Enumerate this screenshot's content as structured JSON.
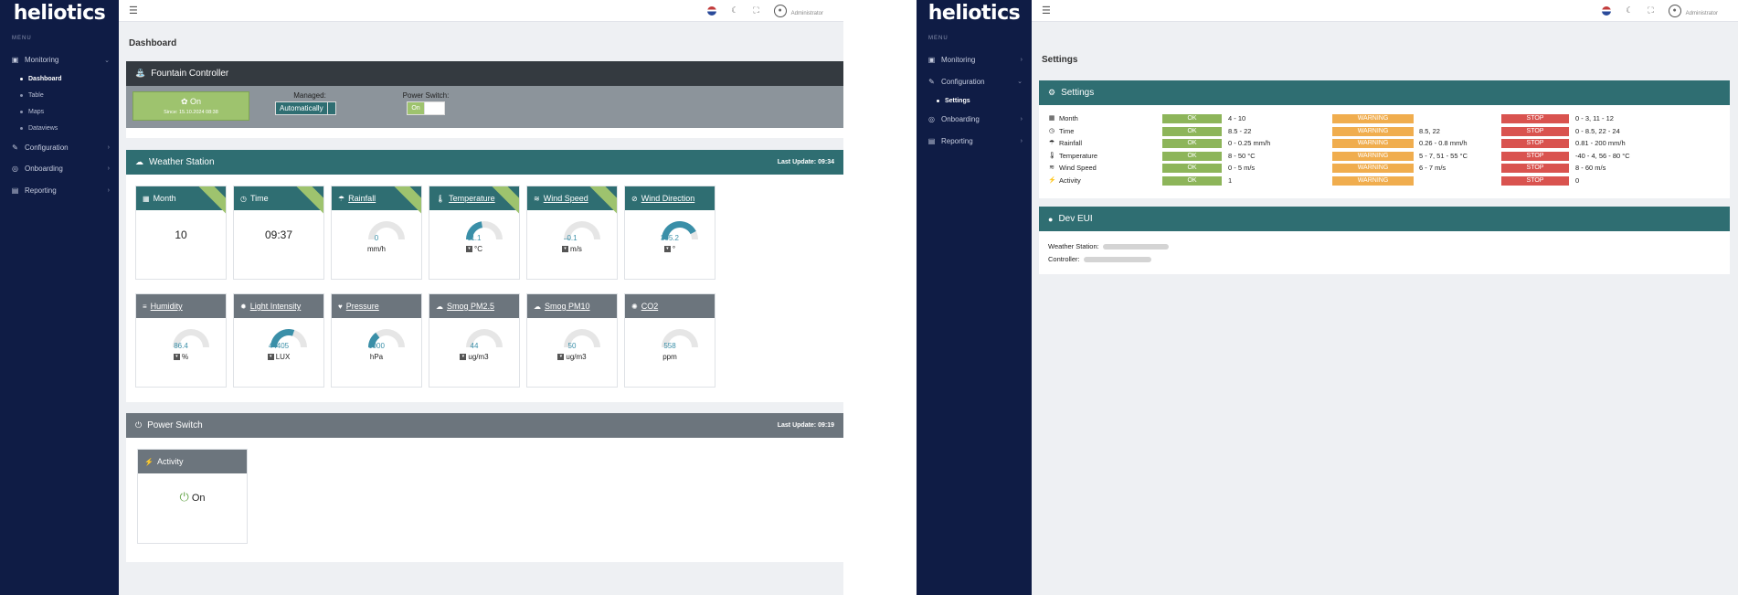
{
  "brand": "heliotics",
  "topbar": {
    "user": "Administrator"
  },
  "menu_label": "MENU",
  "screen1": {
    "sidebar": {
      "items": [
        {
          "label": "Monitoring",
          "chev": "⌄"
        },
        {
          "label": "Configuration",
          "chev": "›"
        },
        {
          "label": "Onboarding",
          "chev": "›"
        },
        {
          "label": "Reporting",
          "chev": "›"
        }
      ],
      "sub": [
        "Dashboard",
        "Table",
        "Maps",
        "Dataviews"
      ]
    },
    "title": "Dashboard",
    "fountain": {
      "title": "Fountain Controller",
      "on_label": "On",
      "since": "Since: 15.10.2024 08:38",
      "managed_label": "Managed:",
      "managed_value": "Automatically",
      "power_label": "Power Switch:",
      "power_value": "On"
    },
    "weather": {
      "title": "Weather Station",
      "last_update": "Last Update: 09:34",
      "tiles": [
        {
          "label": "Month",
          "value": "10"
        },
        {
          "label": "Time",
          "value": "09:37"
        },
        {
          "label": "Rainfall",
          "value": "0",
          "unit": "mm/h",
          "level": 0.0
        },
        {
          "label": "Temperature",
          "value": "11.1",
          "unit": "°C",
          "level": 0.45
        },
        {
          "label": "Wind Speed",
          "value": "0.1",
          "unit": "m/s",
          "level": 0.01
        },
        {
          "label": "Wind Direction",
          "value": "305.2",
          "unit": "°",
          "level": 0.85
        },
        {
          "label": "Humidity",
          "value": "86.4",
          "unit": "%",
          "level": 0.0
        },
        {
          "label": "Light Intensity",
          "value": "44405",
          "unit": "LUX",
          "level": 0.6
        },
        {
          "label": "Pressure",
          "value": "1000",
          "unit": "hPa",
          "level": 0.3
        },
        {
          "label": "Smog PM2.5",
          "value": "44",
          "unit": "ug/m3",
          "level": 0.0
        },
        {
          "label": "Smog PM10",
          "value": "50",
          "unit": "ug/m3",
          "level": 0.0
        },
        {
          "label": "CO2",
          "value": "558",
          "unit": "ppm",
          "level": 0.0
        }
      ]
    },
    "power": {
      "title": "Power Switch",
      "last_update": "Last Update: 09:19",
      "activity_label": "Activity",
      "activity_value": "On"
    }
  },
  "screen2": {
    "sidebar": {
      "items": [
        {
          "label": "Monitoring",
          "chev": "›"
        },
        {
          "label": "Configuration",
          "chev": "⌄"
        },
        {
          "label": "Onboarding",
          "chev": "›"
        },
        {
          "label": "Reporting",
          "chev": "›"
        }
      ],
      "sub": [
        "Settings"
      ]
    },
    "title": "Settings",
    "settings": {
      "title": "Settings",
      "rows": [
        {
          "name": "Month",
          "ok": "OK",
          "ok_range": "4 - 10",
          "warn": "WARNING",
          "warn_range": "",
          "stop": "STOP",
          "stop_range": "0 - 3, 11 - 12"
        },
        {
          "name": "Time",
          "ok": "OK",
          "ok_range": "8.5 - 22",
          "warn": "WARNING",
          "warn_range": "8.5, 22",
          "stop": "STOP",
          "stop_range": "0 - 8.5, 22 - 24"
        },
        {
          "name": "Rainfall",
          "ok": "OK",
          "ok_range": "0 - 0.25 mm/h",
          "warn": "WARNING",
          "warn_range": "0.26 - 0.8 mm/h",
          "stop": "STOP",
          "stop_range": "0.81 - 200 mm/h"
        },
        {
          "name": "Temperature",
          "ok": "OK",
          "ok_range": "8 - 50 °C",
          "warn": "WARNING",
          "warn_range": "5 - 7, 51 - 55 °C",
          "stop": "STOP",
          "stop_range": "-40 - 4, 56 - 80 °C"
        },
        {
          "name": "Wind Speed",
          "ok": "OK",
          "ok_range": "0 - 5 m/s",
          "warn": "WARNING",
          "warn_range": "6 - 7 m/s",
          "stop": "STOP",
          "stop_range": "8 - 60 m/s"
        },
        {
          "name": "Activity",
          "ok": "OK",
          "ok_range": "1",
          "warn": "WARNING",
          "warn_range": "",
          "stop": "STOP",
          "stop_range": "0"
        }
      ]
    },
    "dev_eui": {
      "title": "Dev EUI",
      "weather_label": "Weather Station:",
      "controller_label": "Controller:"
    }
  },
  "colors": {
    "sidebar": "#0f1c45",
    "teal": "#2f6e72",
    "ok": "#8db55a",
    "warning": "#f0ad4e",
    "stop": "#d9534f",
    "gauge": "#3a8fa8"
  }
}
